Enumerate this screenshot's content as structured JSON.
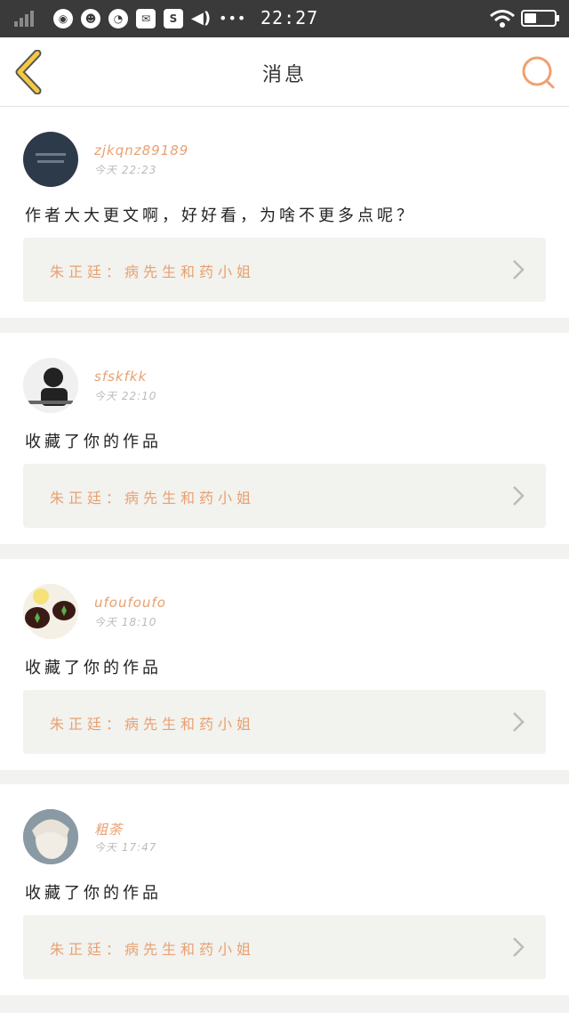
{
  "status_bar": {
    "time": "22:27",
    "notification_icons": [
      "browser-icon",
      "qq-icon",
      "wechat-icon",
      "mail-icon",
      "s-app-icon",
      "volume-icon"
    ],
    "more_dots": "•••"
  },
  "header": {
    "title": "消息"
  },
  "colors": {
    "accent": "#e8a070",
    "back_arrow": "#f5c842",
    "card_bg": "#ffffff",
    "work_box_bg": "#f2f2ee",
    "page_bg": "#f2f2f0"
  },
  "messages": [
    {
      "username": "zjkqnz89189",
      "time": "今天  22:23",
      "text": "作者大大更文啊，好好看，为啥不更多点呢？",
      "work": "朱正廷：病先生和药小姐"
    },
    {
      "username": "sfskfkk",
      "time": "今天  22:10",
      "text": "收藏了你的作品",
      "work": "朱正廷：病先生和药小姐"
    },
    {
      "username": "ufoufoufo",
      "time": "今天  18:10",
      "text": "收藏了你的作品",
      "work": "朱正廷：病先生和药小姐"
    },
    {
      "username": "粗荼",
      "time": "今天  17:47",
      "text": "收藏了你的作品",
      "work": "朱正廷：病先生和药小姐"
    }
  ]
}
